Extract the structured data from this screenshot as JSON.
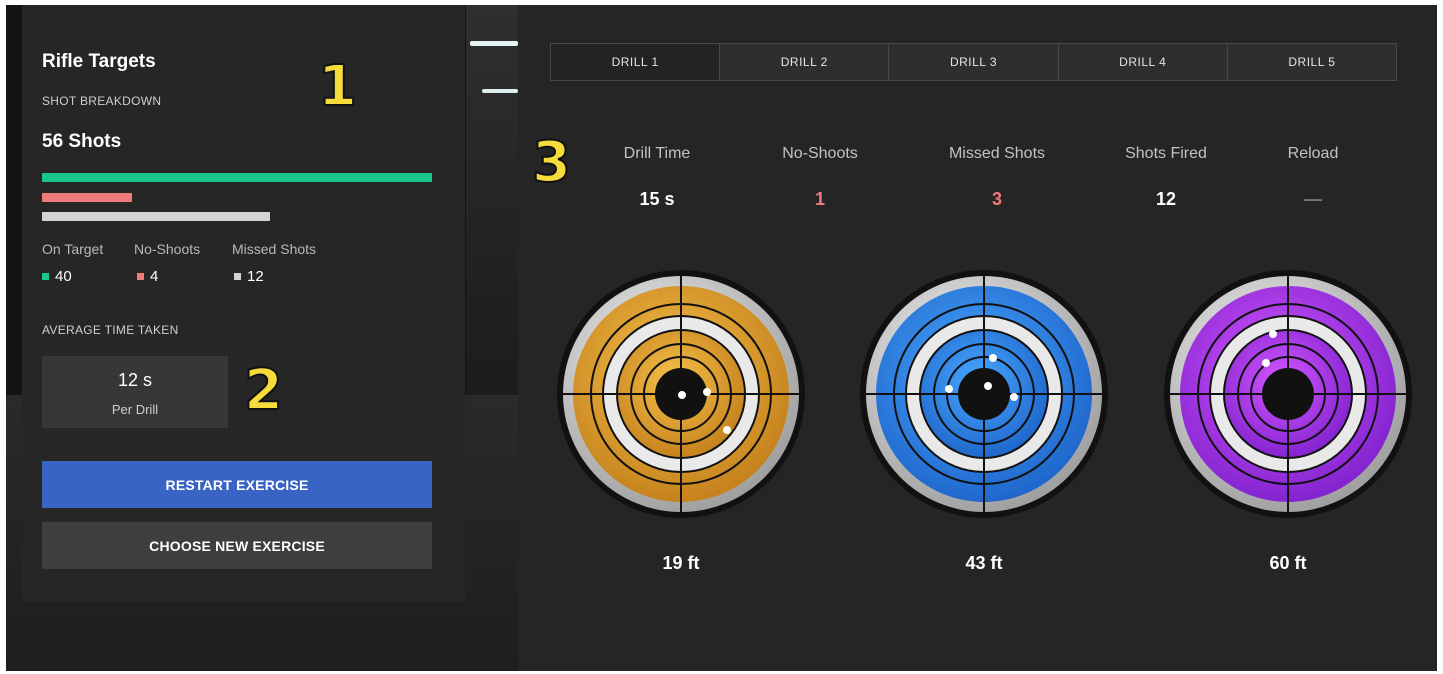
{
  "summary": {
    "title": "Rifle Targets",
    "section_label": "SHOT BREAKDOWN",
    "total_shots": "56 Shots",
    "breakdown": [
      {
        "label": "On Target",
        "value": "40",
        "color": "#19c78b"
      },
      {
        "label": "No-Shoots",
        "value": "4",
        "color": "#f07b7b"
      },
      {
        "label": "Missed Shots",
        "value": "12",
        "color": "#d4d4d4"
      }
    ],
    "avg_label": "AVERAGE TIME TAKEN",
    "avg_value": "12 s",
    "avg_unit": "Per Drill",
    "restart_label": "RESTART EXERCISE",
    "choose_label": "CHOOSE NEW EXERCISE"
  },
  "annotations": [
    "1",
    "2",
    "3"
  ],
  "drills": {
    "tabs": [
      "DRILL 1",
      "DRILL 2",
      "DRILL 3",
      "DRILL 4",
      "DRILL 5"
    ],
    "active_tab": "DRILL 1",
    "stats": [
      {
        "label": "Drill Time",
        "value": "15 s",
        "color": "#ffffff"
      },
      {
        "label": "No-Shoots",
        "value": "1",
        "color": "#f07b7b"
      },
      {
        "label": "Missed Shots",
        "value": "3",
        "color": "#f07b7b"
      },
      {
        "label": "Shots Fired",
        "value": "12",
        "color": "#ffffff"
      },
      {
        "label": "Reload",
        "value": "—",
        "color": "#777777"
      }
    ],
    "targets": [
      {
        "distance": "19 ft",
        "color": "#e2a230",
        "dark": "#8a5a10"
      },
      {
        "distance": "43 ft",
        "color": "#2f8ef0",
        "dark": "#124c9c"
      },
      {
        "distance": "60 ft",
        "color": "#b63ff0",
        "dark": "#5e169a"
      }
    ]
  }
}
